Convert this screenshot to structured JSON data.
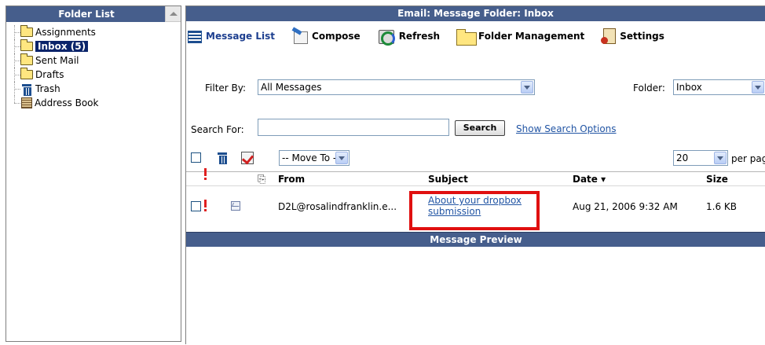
{
  "folder_list": {
    "title": "Folder List",
    "items": [
      {
        "label": "Assignments",
        "icon": "folder-icon"
      },
      {
        "label": "Inbox (5)",
        "icon": "folder-icon",
        "selected": true
      },
      {
        "label": "Sent Mail",
        "icon": "folder-icon"
      },
      {
        "label": "Drafts",
        "icon": "folder-icon"
      },
      {
        "label": "Trash",
        "icon": "trash-icon"
      },
      {
        "label": "Address Book",
        "icon": "address-book-icon"
      }
    ]
  },
  "main": {
    "title": "Email: Message Folder: Inbox",
    "toolbar": {
      "message_list": "Message List",
      "compose": "Compose",
      "refresh": "Refresh",
      "folder_management": "Folder Management",
      "settings": "Settings"
    },
    "filter": {
      "label": "Filter By:",
      "value": "All Messages",
      "folder_label": "Folder:",
      "folder_value": "Inbox"
    },
    "search": {
      "label": "Search For:",
      "value": "",
      "button": "Search",
      "options_link": "Show Search Options"
    },
    "actions": {
      "move_to": "-- Move To --",
      "per_page_value": "20",
      "per_page_label": "per page"
    },
    "table": {
      "headers": {
        "from": "From",
        "subject": "Subject",
        "date": "Date ▾",
        "size": "Size"
      },
      "rows": [
        {
          "from": "D2L@rosalindfranklin.e...",
          "subject_line1": "About your dropbox",
          "subject_line2": "submission",
          "date": "Aug 21, 2006 9:32 AM",
          "size": "1.6 KB",
          "high_priority": true
        }
      ]
    },
    "preview": {
      "title": "Message Preview"
    }
  },
  "colors": {
    "header_bg": "#465e8c",
    "link": "#2255a4",
    "highlight": "#e01010",
    "priority": "#e02020"
  }
}
